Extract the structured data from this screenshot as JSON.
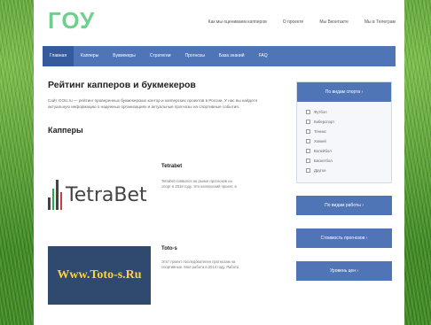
{
  "site": {
    "logo": "ГОУ",
    "top_links": [
      "Как мы оцениваем капперов",
      "О проекте",
      "Мы Вконтакте",
      "Мы в Телеграм"
    ]
  },
  "menu": {
    "items": [
      "Главная",
      "Капперы",
      "Букмекеры",
      "Стратегии",
      "Прогнозы",
      "База знаний",
      "FAQ"
    ],
    "active": "Главная"
  },
  "main": {
    "title": "Рейтинг капперов и букмекеров",
    "intro": "Сайт GOU.ru — рейтинг проверенных букмекерских контор и капперских проектов в России. У нас вы найдете актуальную информацию о надежных организациях и актуальные прогнозы на спортивные события.",
    "section_title": "Капперы",
    "cards": [
      {
        "logo_text": "TetraBet",
        "name": "Tetrabet",
        "desc": "Tetrabet появился на рынке прогнозов на спорт в 2018 году. Это капперский проект, в"
      },
      {
        "logo_text": "Www.Toto-s.Ru",
        "name": "Toto-s",
        "desc": "Этот проект последователен прогнозам на спортивные. Моя работа в 2014 году. Работа"
      }
    ]
  },
  "sidebar": {
    "filter_title": "По видам спорта ›",
    "sports": [
      "Футбол",
      "Киберспорт",
      "Теннис",
      "Хоккей",
      "Волейбол",
      "Баскетбол",
      "Другое"
    ],
    "buttons": [
      "По видам работы ›",
      "Стоимость прогнозов ›",
      "Уровень цен ›"
    ]
  }
}
